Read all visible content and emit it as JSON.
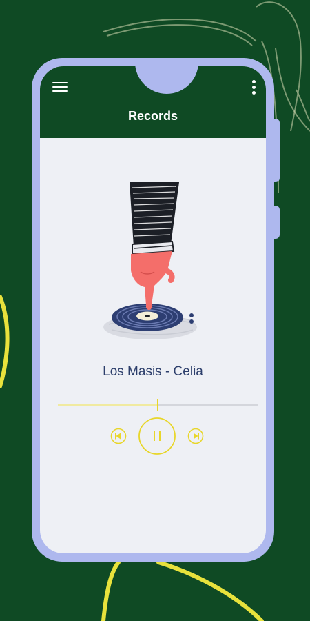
{
  "app": {
    "title": "Records"
  },
  "player": {
    "track": "Los Masis - Celia",
    "progress": 0.5,
    "state": "playing"
  },
  "controls": {
    "prev_icon": "skip-previous-icon",
    "pause_icon": "pause-icon",
    "next_icon": "skip-next-icon"
  },
  "icons": {
    "menu": "menu-icon",
    "more": "more-vertical-icon"
  },
  "colors": {
    "background": "#0f4a24",
    "frame": "#aeb8ee",
    "screen": "#eef0f5",
    "accent": "#e8d62a",
    "track_text": "#2c3e6b"
  }
}
